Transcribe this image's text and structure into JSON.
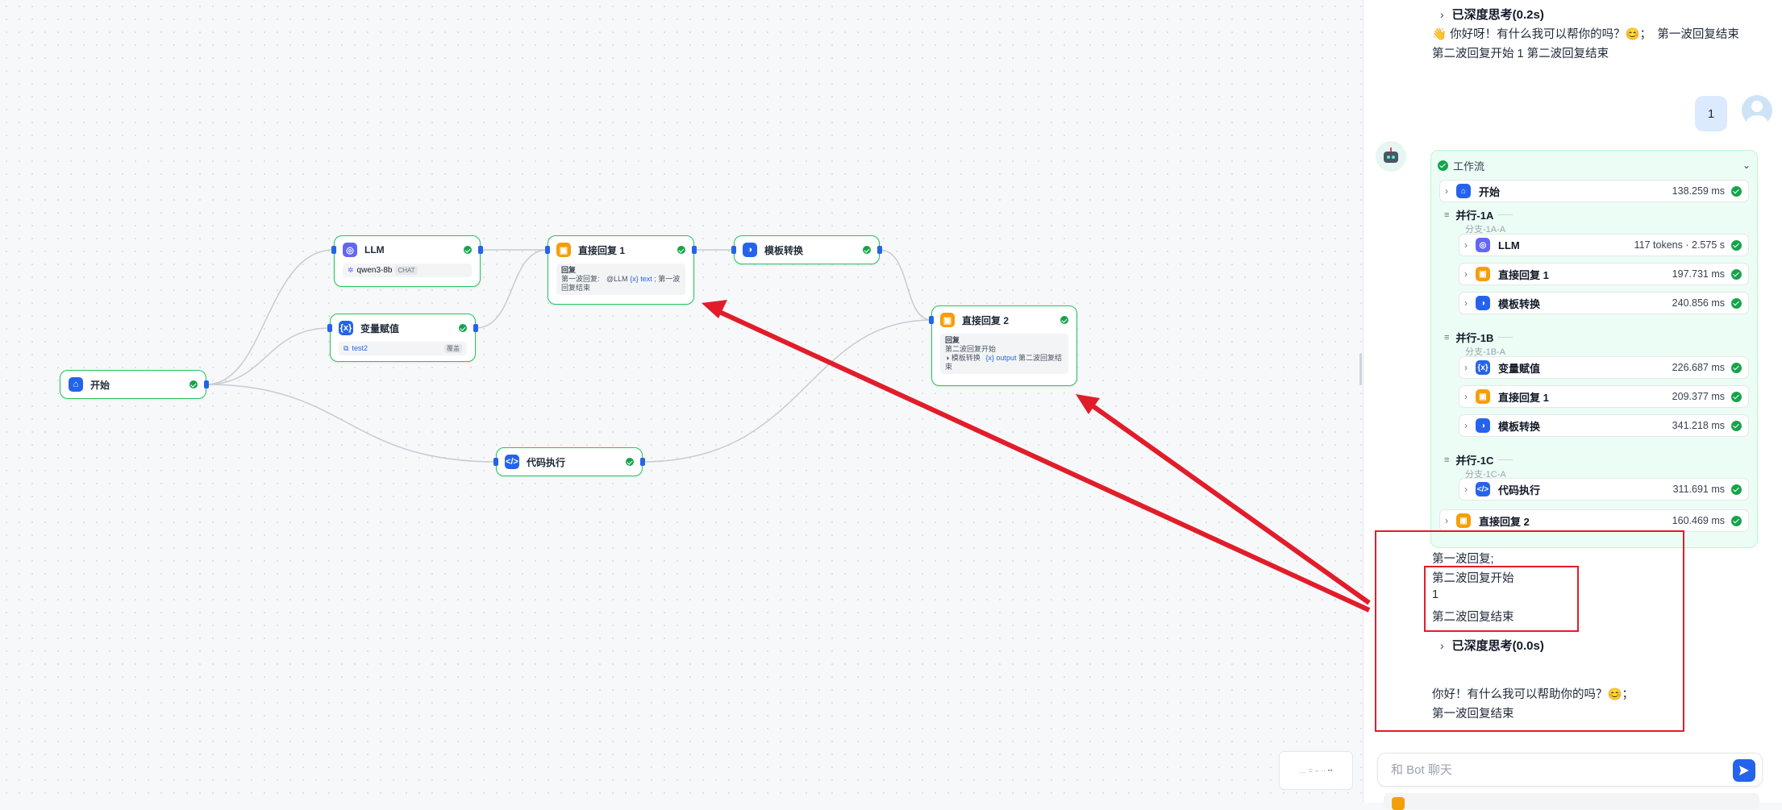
{
  "canvas": {
    "nodes": {
      "start": {
        "title": "开始",
        "icon": "home-icon",
        "color": "#2563eb"
      },
      "llm": {
        "title": "LLM",
        "icon": "llm-icon",
        "color": "#6366f1",
        "model": "qwen3-8b",
        "model_badge": "CHAT"
      },
      "assign": {
        "title": "变量赋值",
        "icon": "variable-icon",
        "color": "#2563eb",
        "var": "test2",
        "mode": "覆盖"
      },
      "reply1": {
        "title": "直接回复 1",
        "icon": "reply-icon",
        "color": "#f59e0b",
        "label": "回复",
        "text_a": "第一波回复:",
        "var_src": "@LLM",
        "var": "{x} text",
        "text_b": "; 第一波回复结束"
      },
      "template": {
        "title": "模板转换",
        "icon": "template-icon",
        "color": "#2563eb"
      },
      "reply2": {
        "title": "直接回复 2",
        "icon": "reply-icon",
        "color": "#f59e0b",
        "label": "回复",
        "text_a": "第二波回复开始",
        "var_src": "◑ 模板转换",
        "var": "{x} output",
        "text_b": "第二波回复结束"
      },
      "code": {
        "title": "代码执行",
        "icon": "code-icon",
        "color": "#2563eb"
      }
    },
    "minimap_text": "… = – ·· ••"
  },
  "chat": {
    "think1": "已深度思考(0.2s)",
    "prev_line1": "👋 你好呀！有什么我可以帮你的吗？😊；　第一波回复结束",
    "prev_line2": "第二波回复开始 1 第二波回复结束",
    "user_message": "1",
    "workflow": {
      "title": "工作流",
      "start": {
        "label": "开始",
        "time": "138.259 ms"
      },
      "parallel_1a": {
        "label": "并行-1A",
        "branch": "分支-1A-A"
      },
      "llm": {
        "label": "LLM",
        "time": "117 tokens · 2.575 s"
      },
      "reply1a": {
        "label": "直接回复 1",
        "time": "197.731 ms"
      },
      "template1a": {
        "label": "模板转换",
        "time": "240.856 ms"
      },
      "parallel_1b": {
        "label": "并行-1B",
        "branch": "分支-1B-A"
      },
      "assign": {
        "label": "变量赋值",
        "time": "226.687 ms"
      },
      "reply1b": {
        "label": "直接回复 1",
        "time": "209.377 ms"
      },
      "template1b": {
        "label": "模板转换",
        "time": "341.218 ms"
      },
      "parallel_1c": {
        "label": "并行-1C",
        "branch": "分支-1C-A"
      },
      "code": {
        "label": "代码执行",
        "time": "311.691 ms"
      },
      "reply2": {
        "label": "直接回复 2",
        "time": "160.469 ms"
      }
    },
    "answer": {
      "line1": "第一波回复;",
      "line2": "第二波回复开始",
      "line3": "1",
      "line4": "第二波回复结束",
      "think2": "已深度思考(0.0s)",
      "line5": "你好！有什么我可以帮助你的吗？😊；",
      "line6": "第一波回复结束"
    },
    "input_placeholder": "和 Bot 聊天"
  },
  "colors": {
    "success": "#16a34a",
    "accent": "#2563eb",
    "reply": "#f59e0b",
    "llm": "#6366f1",
    "highlight": "#e11d2a"
  }
}
